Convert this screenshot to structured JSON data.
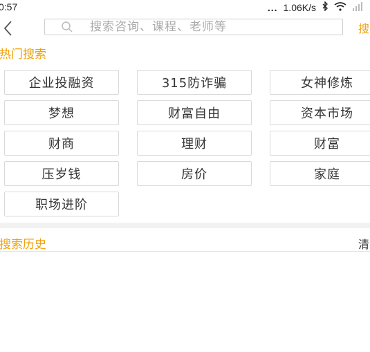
{
  "status_bar": {
    "time": "0:57",
    "dots": "...",
    "net_speed": "1.06K/s",
    "bluetooth_icon": "bluetooth-icon",
    "wifi_icon": "wifi-icon",
    "signal_icon": "signal-icon"
  },
  "search": {
    "back_icon": "chevron-left-icon",
    "placeholder": "搜索咨询、课程、老师等",
    "action_label": "搜"
  },
  "hot": {
    "title": "热门搜索",
    "tags": [
      "企业投融资",
      "315防诈骗",
      "女神修炼",
      "梦想",
      "财富自由",
      "资本市场",
      "财商",
      "理财",
      "财富",
      "压岁钱",
      "房价",
      "家庭",
      "职场进阶"
    ]
  },
  "history": {
    "title": "搜索历史",
    "clear_label": "清"
  },
  "colors": {
    "accent": "#f0a30a",
    "border": "#d9d9d9",
    "band": "#f2f2f2"
  }
}
